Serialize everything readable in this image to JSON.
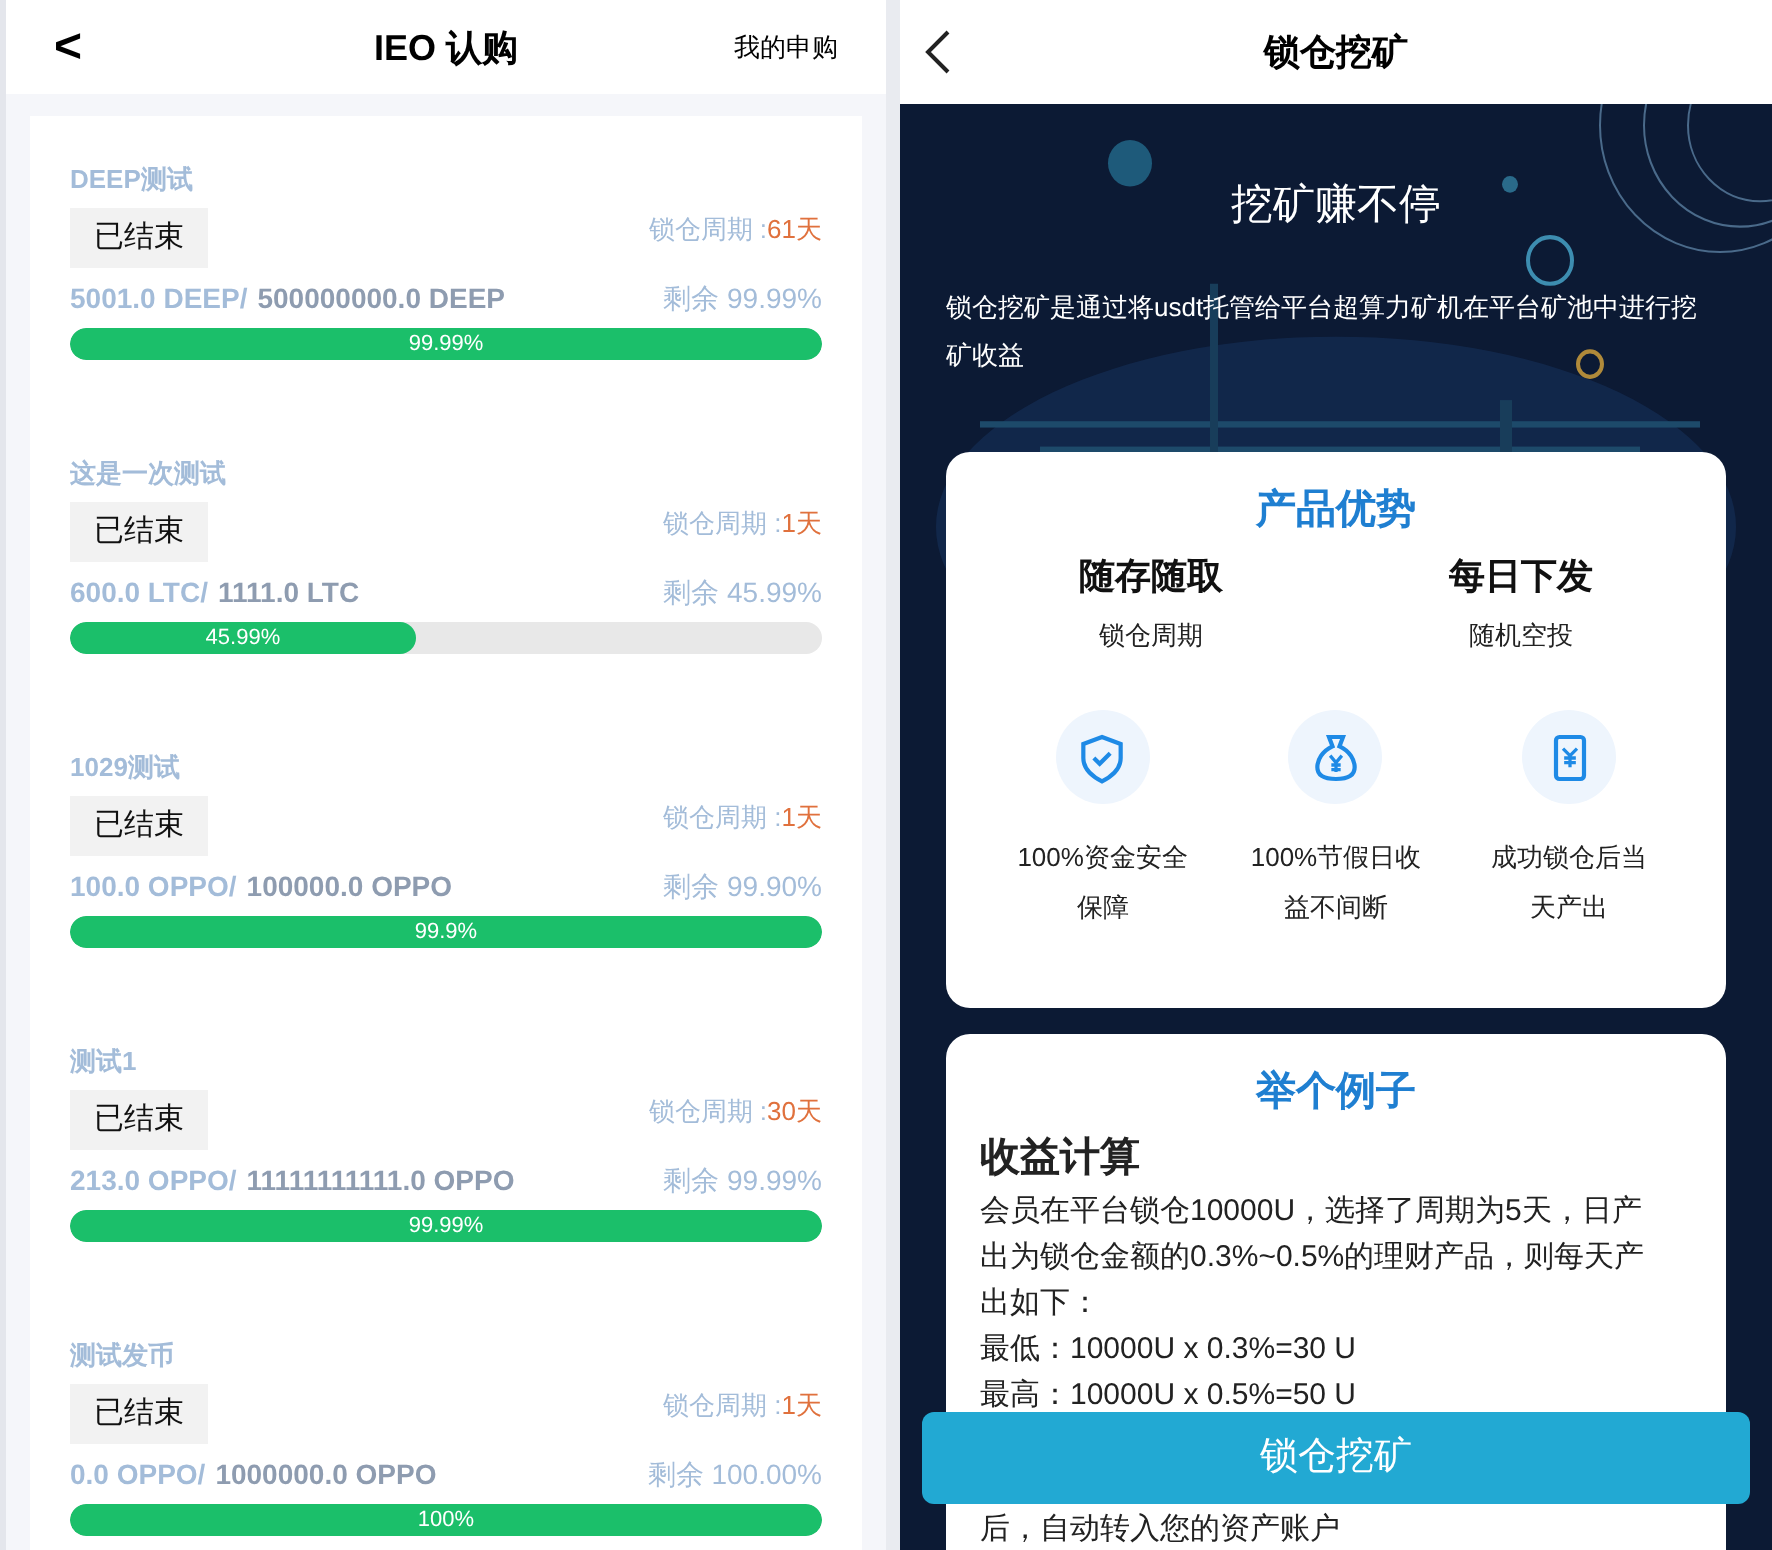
{
  "left": {
    "back": "<",
    "title": "IEO 认购",
    "action": "我的申购",
    "items": [
      {
        "title": "DEEP测试",
        "status": "已结束",
        "period_label": "锁仓周期 :",
        "period_value": "61天",
        "sold": "5001.0 DEEP/",
        "total": "500000000.0 DEEP",
        "remaining_label": "剩余",
        "remaining_value": "99.99%",
        "progress": "99.99%",
        "level": 1
      },
      {
        "title": "这是一次测试",
        "status": "已结束",
        "period_label": "锁仓周期 :",
        "period_value": "1天",
        "sold": "600.0 LTC/",
        "total": "1111.0 LTC",
        "remaining_label": "剩余",
        "remaining_value": "45.99%",
        "progress": "45.99%",
        "level": 0.4599
      },
      {
        "title": "1029测试",
        "status": "已结束",
        "period_label": "锁仓周期 :",
        "period_value": "1天",
        "sold": "100.0 OPPO/",
        "total": "100000.0 OPPO",
        "remaining_label": "剩余",
        "remaining_value": "99.90%",
        "progress": "99.9%",
        "level": 1
      },
      {
        "title": "测试1",
        "status": "已结束",
        "period_label": "锁仓周期 :",
        "period_value": "30天",
        "sold": "213.0 OPPO/",
        "total": "11111111111.0 OPPO",
        "remaining_label": "剩余",
        "remaining_value": "99.99%",
        "progress": "99.99%",
        "level": 1
      },
      {
        "title": "测试发币",
        "status": "已结束",
        "period_label": "锁仓周期 :",
        "period_value": "1天",
        "sold": "0.0 OPPO/",
        "total": "1000000.0 OPPO",
        "remaining_label": "剩余",
        "remaining_value": "100.00%",
        "progress": "100%",
        "level": 1
      }
    ]
  },
  "right": {
    "title": "锁仓挖矿",
    "hero": "挖矿赚不停",
    "description": "锁仓挖矿是通过将usdt托管给平台超算力矿机在平台矿池中进行挖矿收益",
    "advantages": {
      "title": "产品优势",
      "highlights": [
        {
          "title": "随存随取",
          "subtitle": "锁仓周期"
        },
        {
          "title": "每日下发",
          "subtitle": "随机空投"
        }
      ],
      "features": [
        {
          "kind": "shield",
          "text": "100%资金安全保障"
        },
        {
          "kind": "moneybag",
          "text": "100%节假日收益不间断"
        },
        {
          "kind": "receipt",
          "text": "成功锁仓后当天产出"
        }
      ]
    },
    "example": {
      "title": "举个例子",
      "heading": "收益计算",
      "paragraph": "会员在平台锁仓10000U，选择了周期为5天，日产出为锁仓金额的0.3%~0.5%的理财产品，则每天产出如下：",
      "lines": [
        "最低：10000U x 0.3%=30 U",
        "最高：10000U x 0.5%=50 U"
      ],
      "tail": "后，自动转入您的资产账户"
    },
    "button": "锁仓挖矿"
  }
}
